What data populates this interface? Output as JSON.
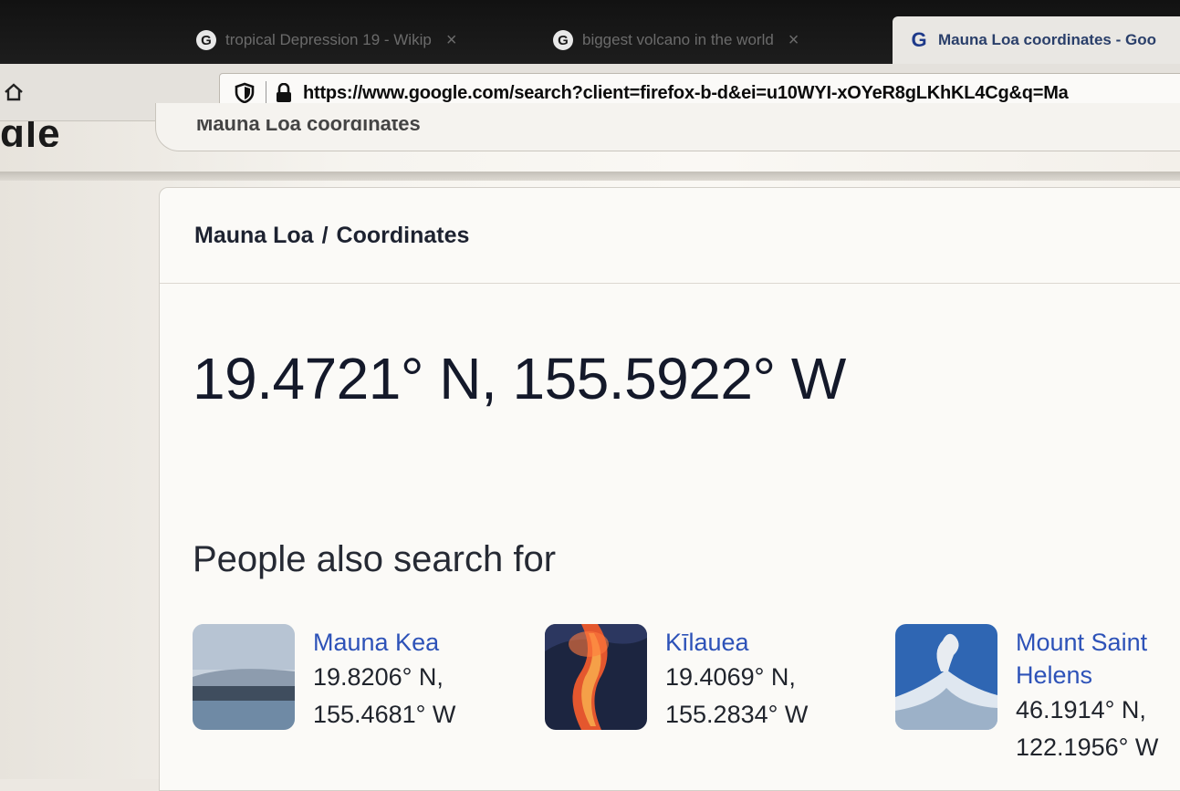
{
  "browser": {
    "tabs": [
      {
        "title": "tropical Depression 19 - Wikip",
        "active": false,
        "close": "×"
      },
      {
        "title": "biggest volcano in the world",
        "active": false,
        "close": "×"
      },
      {
        "title": "Mauna Loa coordinates - Goo",
        "active": true,
        "close": ""
      }
    ],
    "favicon_letter": "G",
    "url": "https://www.google.com/search?client=firefox-b-d&ei=u10WYI-xOYeR8gLKhKL4Cg&q=Ma"
  },
  "page": {
    "logo_fragment": "gle",
    "search_query": "Mauna Loa coordinates",
    "breadcrumb": {
      "entity": "Mauna Loa",
      "separator": "/",
      "attribute": "Coordinates"
    },
    "answer": "19.4721° N, 155.5922° W",
    "people_also_search_for": {
      "title": "People also search for",
      "items": [
        {
          "name": "Mauna Kea",
          "lat": "19.8206° N,",
          "lon": "155.4681° W"
        },
        {
          "name": "Kīlauea",
          "lat": "19.4069° N,",
          "lon": "155.2834° W"
        },
        {
          "name": "Mount Saint Helens",
          "name_line1": "Mount Saint",
          "name_line2": "Helens",
          "lat": "46.1914° N,",
          "lon": "122.1956° W"
        }
      ]
    }
  },
  "colors": {
    "link": "#2d52b8",
    "text": "#14192a",
    "tab_strip": "#121212"
  }
}
